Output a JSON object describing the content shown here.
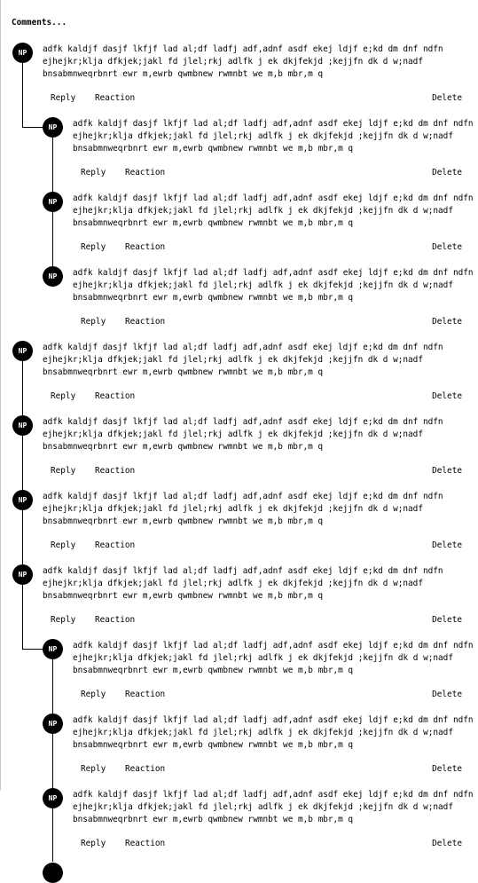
{
  "header": {
    "title": "Comments..."
  },
  "avatar_initials": "NP",
  "comment_text": "adfk kaldjf dasjf lkfjf lad al;df ladfj adf,adnf asdf ekej ldjf e;kd dm dnf ndfn ejhejkr;klja dfkjek;jakl fd jlel;rkj adlfk j ek dkjfekjd ;kejjfn dk d w;nadf bnsabmnweqrbnrt ewr m,ewrb qwmbnew rwmnbt we m,b mbr,m q",
  "actions": {
    "reply": "Reply",
    "reaction": "Reaction",
    "delete": "Delete"
  },
  "comments": [
    {
      "level": 0
    },
    {
      "level": 1
    },
    {
      "level": 1
    },
    {
      "level": 1
    },
    {
      "level": 0
    },
    {
      "level": 0
    },
    {
      "level": 0
    },
    {
      "level": 0
    },
    {
      "level": 1
    },
    {
      "level": 1
    },
    {
      "level": 1
    }
  ]
}
